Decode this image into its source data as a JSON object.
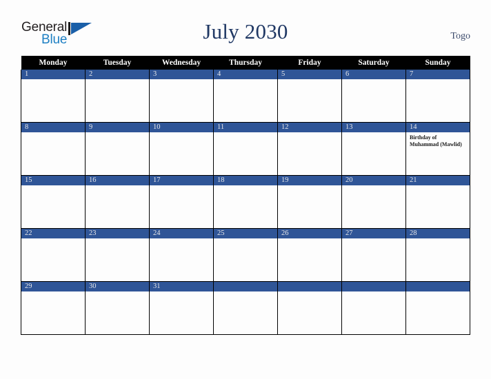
{
  "brand": {
    "name_part1": "General",
    "name_part2": "Blue",
    "mark_icon": "triangle-flag-icon"
  },
  "header": {
    "title": "July 2030",
    "country": "Togo"
  },
  "calendar": {
    "weekdays": [
      "Monday",
      "Tuesday",
      "Wednesday",
      "Thursday",
      "Friday",
      "Saturday",
      "Sunday"
    ],
    "colors": {
      "date_bar": "#2f5597",
      "header_bar": "#010101",
      "title": "#203864",
      "brand_blue": "#1d7fc3",
      "cell_bg": "#fdfdfd",
      "grid_line": "#000000"
    },
    "weeks": [
      [
        {
          "day": "1",
          "events": []
        },
        {
          "day": "2",
          "events": []
        },
        {
          "day": "3",
          "events": []
        },
        {
          "day": "4",
          "events": []
        },
        {
          "day": "5",
          "events": []
        },
        {
          "day": "6",
          "events": []
        },
        {
          "day": "7",
          "events": []
        }
      ],
      [
        {
          "day": "8",
          "events": []
        },
        {
          "day": "9",
          "events": []
        },
        {
          "day": "10",
          "events": []
        },
        {
          "day": "11",
          "events": []
        },
        {
          "day": "12",
          "events": []
        },
        {
          "day": "13",
          "events": []
        },
        {
          "day": "14",
          "events": [
            "Birthday of Muhammad (Mawlid)"
          ]
        }
      ],
      [
        {
          "day": "15",
          "events": []
        },
        {
          "day": "16",
          "events": []
        },
        {
          "day": "17",
          "events": []
        },
        {
          "day": "18",
          "events": []
        },
        {
          "day": "19",
          "events": []
        },
        {
          "day": "20",
          "events": []
        },
        {
          "day": "21",
          "events": []
        }
      ],
      [
        {
          "day": "22",
          "events": []
        },
        {
          "day": "23",
          "events": []
        },
        {
          "day": "24",
          "events": []
        },
        {
          "day": "25",
          "events": []
        },
        {
          "day": "26",
          "events": []
        },
        {
          "day": "27",
          "events": []
        },
        {
          "day": "28",
          "events": []
        }
      ],
      [
        {
          "day": "29",
          "events": []
        },
        {
          "day": "30",
          "events": []
        },
        {
          "day": "31",
          "events": []
        },
        {
          "day": "",
          "events": []
        },
        {
          "day": "",
          "events": []
        },
        {
          "day": "",
          "events": []
        },
        {
          "day": "",
          "events": []
        }
      ]
    ]
  }
}
